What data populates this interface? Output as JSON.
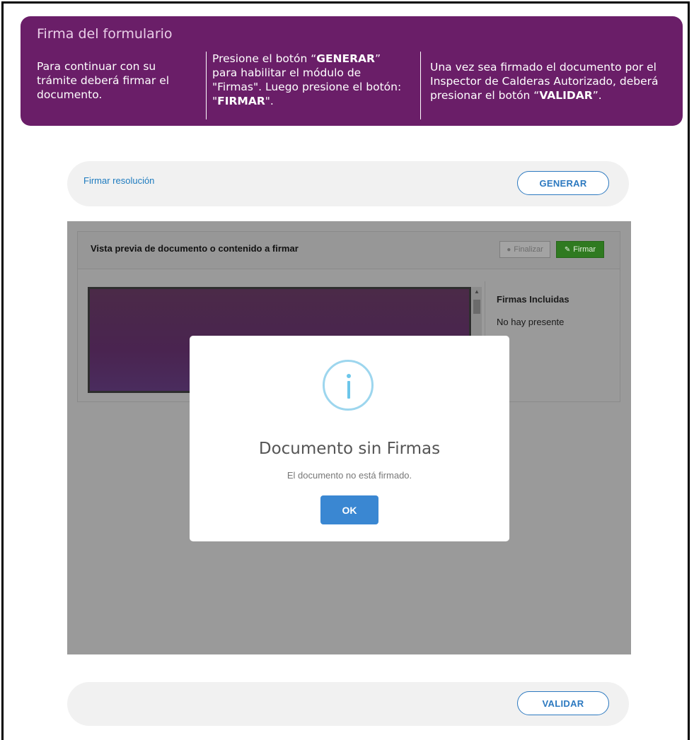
{
  "banner": {
    "title": "Firma del formulario",
    "col1": "Para continuar con su trámite deberá firmar el documento.",
    "col2_a": "Presione el botón “",
    "col2_b": "GENERAR",
    "col2_c": "” para habilitar el módulo de \"Firmas\". Luego presione el botón: \"",
    "col2_d": "FIRMAR",
    "col2_e": "\".",
    "col3_a": "Una vez sea firmado el documento por el Inspector de Calderas Autorizado, deberá presionar el botón “",
    "col3_b": "VALIDAR",
    "col3_c": "”."
  },
  "top_bar": {
    "link": "Firmar resolución",
    "button": "GENERAR"
  },
  "panel": {
    "title": "Vista previa de documento o contenido a firmar",
    "finalizar": "Finalizar",
    "firmar": "Firmar",
    "signatures_title": "Firmas Incluidas",
    "signatures_empty": "No hay presente"
  },
  "modal": {
    "title": "Documento sin Firmas",
    "text": "El documento no está firmado.",
    "ok": "OK"
  },
  "bottom_bar": {
    "button": "VALIDAR"
  },
  "colors": {
    "banner_bg": "#6a1e68",
    "accent_blue": "#2c79c0",
    "firmar_green": "#2f7a20",
    "ok_blue": "#3a87d2"
  }
}
